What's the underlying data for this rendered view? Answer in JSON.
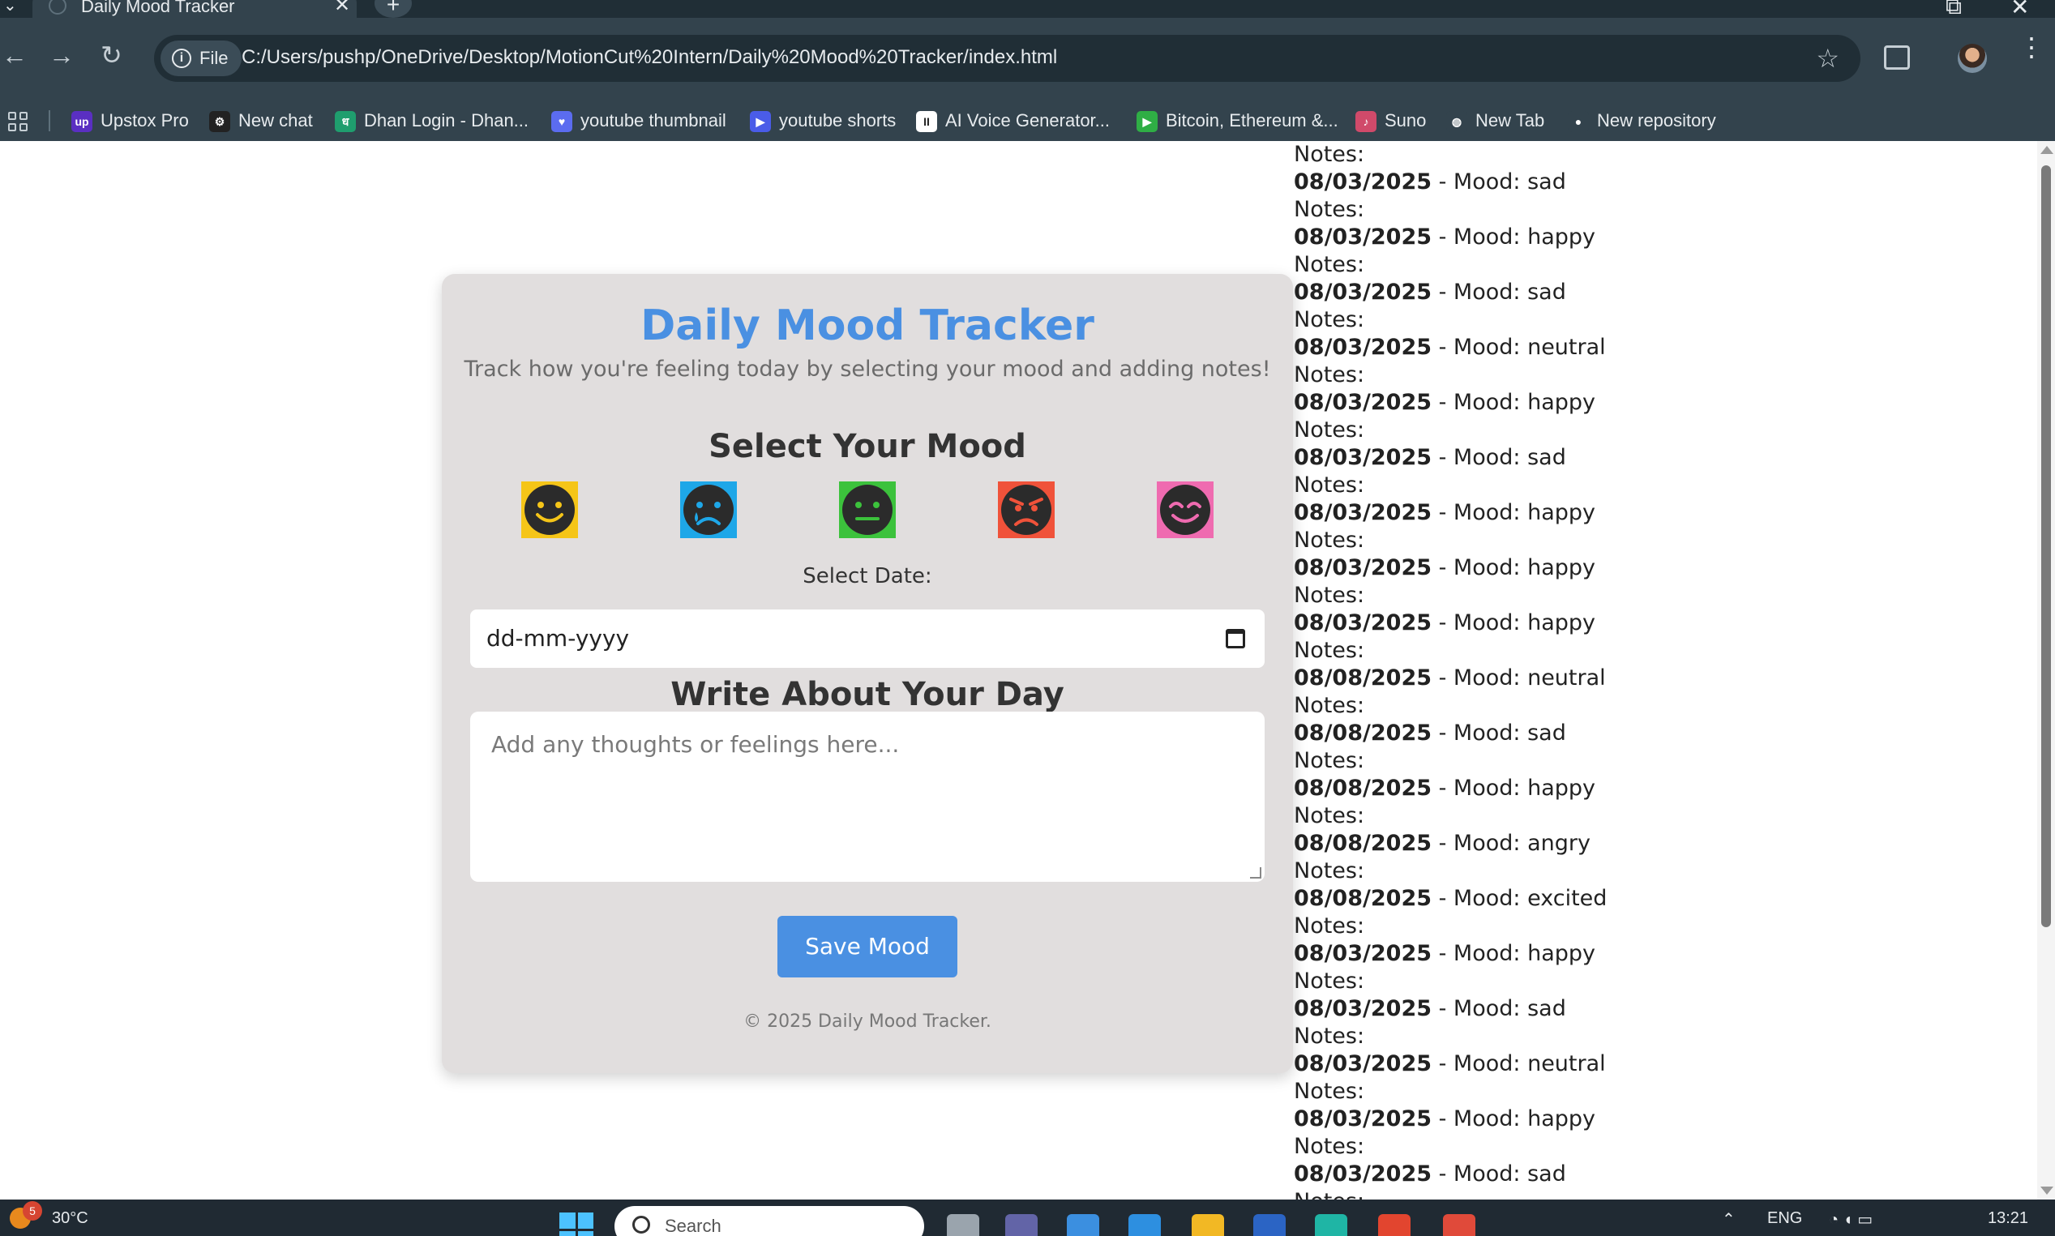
{
  "browser": {
    "tab_title": "Daily Mood Tracker",
    "tab_close": "✕",
    "new_tab": "+",
    "window_restore": "⧉",
    "window_close": "✕",
    "back": "←",
    "forward": "→",
    "reload": "↻",
    "site_info_label": "File",
    "site_info_icon": "i",
    "url": "C:/Users/pushp/OneDrive/Desktop/MotionCut%20Intern/Daily%20Mood%20Tracker/index.html",
    "bookmark_star": "☆",
    "menu_dots": "⋮",
    "bookmarks": [
      {
        "label": "Upstox Pro",
        "icon": "up",
        "color": "#5a2fc2"
      },
      {
        "label": "New chat",
        "icon": "⚙",
        "color": "#222222"
      },
      {
        "label": "Dhan Login - Dhan...",
        "icon": "ध",
        "color": "#1f9e6e"
      },
      {
        "label": "youtube thumbnail",
        "icon": "♥",
        "color": "#5b6cf0"
      },
      {
        "label": "youtube shorts",
        "icon": "▶",
        "color": "#4a5ce8"
      },
      {
        "label": "AI Voice Generator...",
        "icon": "II",
        "color": "#ffffff"
      },
      {
        "label": "Bitcoin, Ethereum &...",
        "icon": "▶",
        "color": "#2fae45"
      },
      {
        "label": "Suno",
        "icon": "♪",
        "color": "#d04a6a"
      },
      {
        "label": "New Tab",
        "icon": "◍",
        "color": "#33434d"
      },
      {
        "label": "New repository",
        "icon": "●",
        "color": "#33434d"
      }
    ]
  },
  "app": {
    "title": "Daily Mood Tracker",
    "subtitle": "Track how you're feeling today by selecting your mood and adding notes!",
    "select_mood_heading": "Select Your Mood",
    "moods": [
      {
        "name": "happy",
        "color": "#f5c518"
      },
      {
        "name": "sad",
        "color": "#1ea7e8"
      },
      {
        "name": "neutral",
        "color": "#3cc23c"
      },
      {
        "name": "angry",
        "color": "#f0523a"
      },
      {
        "name": "excited",
        "color": "#ef6bb0"
      }
    ],
    "select_date_label": "Select Date:",
    "date_value": "dd-mm-yyyy",
    "write_heading": "Write About Your Day",
    "notes_placeholder": "Add any thoughts or feelings here...",
    "save_button": "Save Mood",
    "footer": "© 2025 Daily Mood Tracker."
  },
  "entries": {
    "top_notes_label": "Notes:",
    "notes_label": "Notes:",
    "mood_prefix": " - Mood: ",
    "items": [
      {
        "date": "08/03/2025",
        "mood": "sad"
      },
      {
        "date": "08/03/2025",
        "mood": "happy"
      },
      {
        "date": "08/03/2025",
        "mood": "sad"
      },
      {
        "date": "08/03/2025",
        "mood": "neutral"
      },
      {
        "date": "08/03/2025",
        "mood": "happy"
      },
      {
        "date": "08/03/2025",
        "mood": "sad"
      },
      {
        "date": "08/03/2025",
        "mood": "happy"
      },
      {
        "date": "08/03/2025",
        "mood": "happy"
      },
      {
        "date": "08/03/2025",
        "mood": "happy"
      },
      {
        "date": "08/08/2025",
        "mood": "neutral"
      },
      {
        "date": "08/08/2025",
        "mood": "sad"
      },
      {
        "date": "08/08/2025",
        "mood": "happy"
      },
      {
        "date": "08/08/2025",
        "mood": "angry"
      },
      {
        "date": "08/08/2025",
        "mood": "excited"
      },
      {
        "date": "08/03/2025",
        "mood": "happy"
      },
      {
        "date": "08/03/2025",
        "mood": "sad"
      },
      {
        "date": "08/03/2025",
        "mood": "neutral"
      },
      {
        "date": "08/03/2025",
        "mood": "happy"
      },
      {
        "date": "08/03/2025",
        "mood": "sad"
      }
    ]
  },
  "taskbar": {
    "weather_badge": "5",
    "temperature": "30°C",
    "search_placeholder": "Search",
    "language": "ENG",
    "time": "13:21",
    "tray_icons": "⌃",
    "apps": [
      {
        "name": "task-view-icon",
        "color": "#9aa4ad"
      },
      {
        "name": "teams-icon",
        "color": "#6264a7"
      },
      {
        "name": "copilot-icon",
        "color": "#3b8fe0"
      },
      {
        "name": "vscode-icon",
        "color": "#2d8fe0"
      },
      {
        "name": "file-explorer-icon",
        "color": "#f2b824"
      },
      {
        "name": "word-icon",
        "color": "#2b64c4"
      },
      {
        "name": "edge-icon",
        "color": "#1fb5a5"
      },
      {
        "name": "store-icon",
        "color": "#e2452f"
      },
      {
        "name": "chrome-icon",
        "color": "#e04a3a"
      }
    ]
  }
}
